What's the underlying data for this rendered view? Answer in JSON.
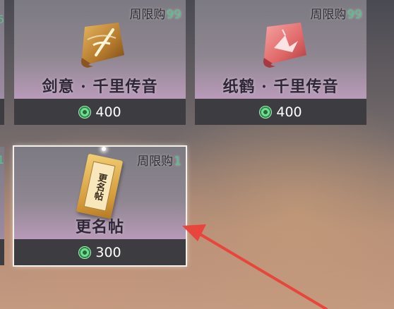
{
  "shop": {
    "items": [
      {
        "limit_label": "周限购",
        "limit_count": "99",
        "name": "剑意 · 千里传音",
        "price": "400",
        "icon": "sword-scroll-icon"
      },
      {
        "limit_label": "周限购",
        "limit_count": "99",
        "name": "纸鹤 · 千里传音",
        "price": "400",
        "icon": "paper-crane-scroll-icon"
      },
      {
        "limit_label": "周限购",
        "limit_count": "1",
        "name": "更名帖",
        "price": "300",
        "icon": "rename-card-icon",
        "icon_text": "更名帖"
      }
    ],
    "left_edge": {
      "row1_count": "5",
      "row2_count": "1"
    },
    "currency_icon": "jade-coin-icon"
  },
  "colors": {
    "limit_count": "#58c08a",
    "price_bar": "#3d3c40",
    "annotation_arrow": "#e8453c"
  },
  "annotation": {
    "icon": "red-arrow-icon",
    "points_to": "更名帖"
  }
}
